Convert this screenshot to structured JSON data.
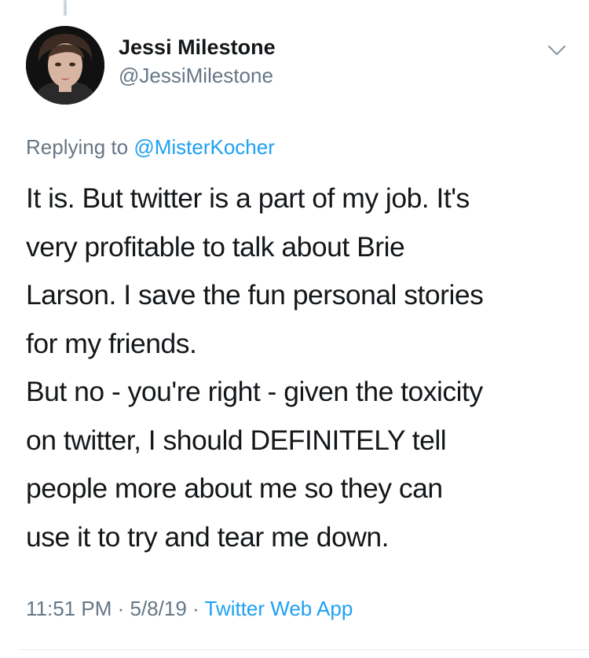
{
  "author": {
    "display_name": "Jessi Milestone",
    "handle": "@JessiMilestone"
  },
  "reply": {
    "prefix": "Replying to",
    "mention": "@MisterKocher"
  },
  "tweet": {
    "lines": [
      "It is. But twitter is a part of my job. It's",
      "very profitable to talk about Brie",
      "Larson. I save the fun personal stories",
      "for my friends.",
      "But no - you're right - given the toxicity",
      "on twitter, I should DEFINITELY tell",
      "people more about me so they can",
      "use it to try and tear me down."
    ]
  },
  "meta": {
    "time": "11:51 PM",
    "date": "5/8/19",
    "separator": "·",
    "source": "Twitter Web App"
  },
  "icons": {
    "menu": "chevron-down-icon",
    "avatar": "profile-photo"
  },
  "colors": {
    "link": "#1da1f2",
    "secondary_text": "#657786",
    "primary_text": "#14171a",
    "thread_line": "#ccd6dd"
  }
}
